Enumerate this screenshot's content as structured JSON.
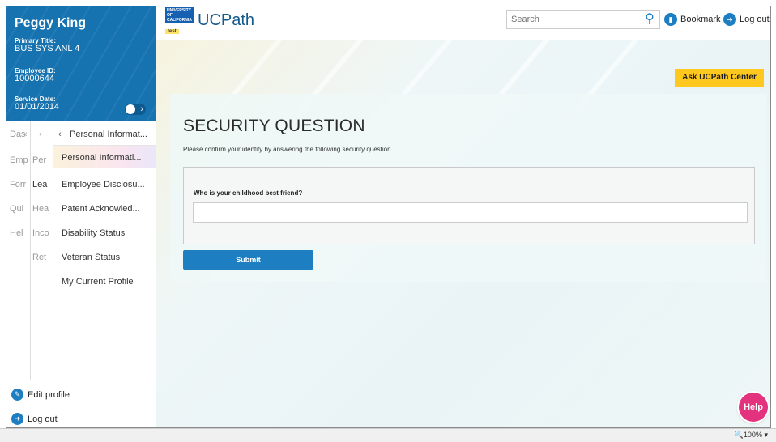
{
  "profile": {
    "name": "Peggy King",
    "primary_title_label": "Primary Title:",
    "primary_title": "BUS SYS ANL 4",
    "employee_id_label": "Employee ID:",
    "employee_id": "10000644",
    "service_date_label": "Service Date:",
    "service_date": "01/01/2014"
  },
  "nav": {
    "col1": [
      "Das",
      "Emp",
      "Forr",
      "Qui",
      "Hel"
    ],
    "col2": [
      "Per",
      "Lea",
      "Hea",
      "Inco",
      "Ret"
    ],
    "col3_header": "Personal Informat...",
    "col3": [
      "Personal Informati...",
      "Employee Disclosu...",
      "Patent Acknowled...",
      "Disability Status",
      "Veteran Status",
      "My Current Profile"
    ]
  },
  "profile_actions": {
    "edit": "Edit profile",
    "logout": "Log out"
  },
  "topbar": {
    "logo_text": "UNIVERSITY OF CALIFORNIA",
    "logo_tag": "test",
    "brand": "UCPath",
    "search_placeholder": "Search",
    "bookmark": "Bookmark",
    "logout": "Log out"
  },
  "main": {
    "ask_button": "Ask UCPath Center",
    "title": "SECURITY QUESTION",
    "subtitle": "Please confirm your identity by answering the following security question.",
    "question": "Who is your childhood best friend?",
    "answer_value": "",
    "submit": "Submit",
    "help": "Help"
  },
  "statusbar": {
    "zoom": "100%"
  },
  "colors": {
    "brand_blue": "#1773b0",
    "accent_yellow": "#ffc81e",
    "help_pink": "#e3337f"
  }
}
